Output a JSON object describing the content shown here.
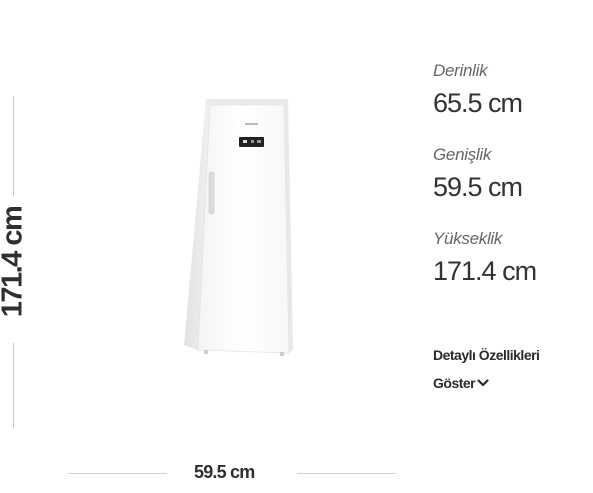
{
  "dimensions": {
    "height_label": "171.4 cm",
    "width_label": "59.5 cm"
  },
  "product": {
    "image_icon": "freezer-appliance-icon",
    "display_color": "#222222"
  },
  "specs": [
    {
      "label": "Derinlik",
      "value": "65.5 cm"
    },
    {
      "label": "Genişlik",
      "value": "59.5 cm"
    },
    {
      "label": "Yükseklik",
      "value": "171.4 cm"
    }
  ],
  "details": {
    "line1": "Detaylı Özellikleri",
    "line2": "Göster",
    "icon": "chevron-down-icon"
  },
  "colors": {
    "text_primary": "#333333",
    "text_label": "#666666",
    "divider": "#c8c8c8"
  }
}
